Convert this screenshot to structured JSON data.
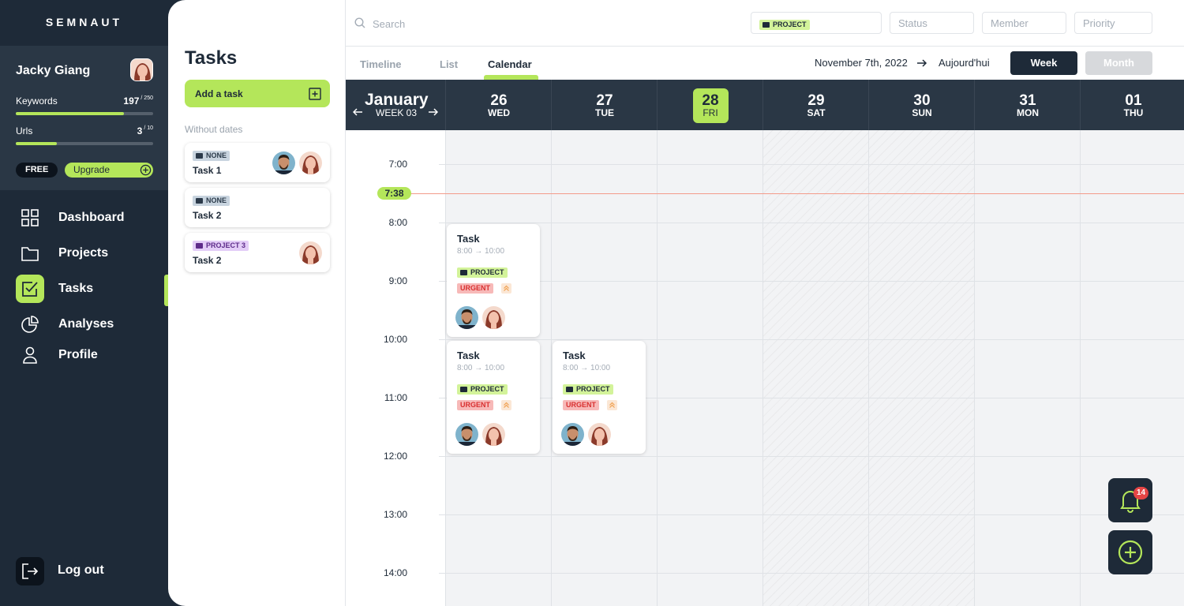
{
  "brand": "SEMNAUT",
  "user": {
    "name": "Jacky Giang",
    "keywords_label": "Keywords",
    "keywords_value": "197",
    "keywords_max": "/ 250",
    "keywords_progress": 0.79,
    "urls_label": "Urls",
    "urls_value": "3",
    "urls_max": "/ 10",
    "urls_progress": 0.3,
    "plan": "FREE",
    "upgrade_label": "Upgrade"
  },
  "nav": [
    {
      "label": "Dashboard",
      "icon": "grid-icon"
    },
    {
      "label": "Projects",
      "icon": "folder-icon"
    },
    {
      "label": "Tasks",
      "icon": "checkbox-icon",
      "active": true
    },
    {
      "label": "Analyses",
      "icon": "pie-chart-icon"
    },
    {
      "label": "Profile",
      "icon": "user-icon"
    }
  ],
  "logout_label": "Log out",
  "tasks_panel": {
    "title": "Tasks",
    "add_label": "Add a task",
    "without_dates_label": "Without dates",
    "items": [
      {
        "tag": "NONE",
        "name": "Task 1"
      },
      {
        "tag": "NONE",
        "name": "Task 2"
      },
      {
        "tag": "PROJECT 3",
        "name": "Task 2"
      }
    ]
  },
  "topbar": {
    "search_placeholder": "Search",
    "project_filter": "PROJECT",
    "status_placeholder": "Status",
    "member_placeholder": "Member",
    "priority_placeholder": "Priority"
  },
  "tabs": [
    "Timeline",
    "List",
    "Calendar"
  ],
  "date_text": "November 7th, 2022",
  "today_label": "Aujourd'hui",
  "week_label": "Week",
  "month_label": "Month",
  "calendar": {
    "month": "January",
    "week": "WEEK 03",
    "days": [
      {
        "num": "26",
        "name": "WED"
      },
      {
        "num": "27",
        "name": "TUE"
      },
      {
        "num": "28",
        "name": "FRI",
        "today": true
      },
      {
        "num": "29",
        "name": "SAT"
      },
      {
        "num": "30",
        "name": "SUN"
      },
      {
        "num": "31",
        "name": "MON"
      },
      {
        "num": "01",
        "name": "THU"
      }
    ],
    "hours": [
      "7:00",
      "8:00",
      "9:00",
      "10:00",
      "11:00",
      "12:00",
      "13:00",
      "14:00"
    ],
    "now": "7:38",
    "events": [
      {
        "title": "Task",
        "time": "8:00 → 10:00",
        "project": "PROJECT",
        "priority": "URGENT"
      },
      {
        "title": "Task",
        "time": "8:00 → 10:00",
        "project": "PROJECT",
        "priority": "URGENT"
      },
      {
        "title": "Task",
        "time": "8:00 → 10:00",
        "project": "PROJECT",
        "priority": "URGENT"
      }
    ]
  },
  "notifications_count": "14",
  "colors": {
    "accent": "#b4e65a",
    "dark": "#1e2a38",
    "urgent": "#d93030",
    "now_line": "#f39b8a"
  }
}
